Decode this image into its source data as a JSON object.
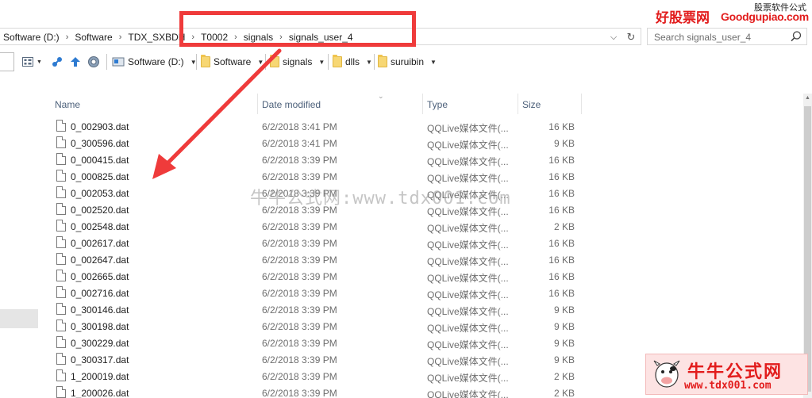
{
  "breadcrumbs": [
    "Software (D:)",
    "Software",
    "TDX_SXBDH",
    "T0002",
    "signals",
    "signals_user_4"
  ],
  "search": {
    "placeholder": "Search signals_user_4"
  },
  "toolbar": {
    "drive_label": "Software (D:)",
    "folders": [
      "Software",
      "signals",
      "dlls",
      "suruibin"
    ]
  },
  "columns": {
    "name": "Name",
    "date": "Date modified",
    "type": "Type",
    "size": "Size"
  },
  "files": [
    {
      "name": "0_002903.dat",
      "date": "6/2/2018 3:41 PM",
      "type": "QQLive媒体文件(...",
      "size": "16 KB"
    },
    {
      "name": "0_300596.dat",
      "date": "6/2/2018 3:41 PM",
      "type": "QQLive媒体文件(...",
      "size": "9 KB"
    },
    {
      "name": "0_000415.dat",
      "date": "6/2/2018 3:39 PM",
      "type": "QQLive媒体文件(...",
      "size": "16 KB"
    },
    {
      "name": "0_000825.dat",
      "date": "6/2/2018 3:39 PM",
      "type": "QQLive媒体文件(...",
      "size": "16 KB"
    },
    {
      "name": "0_002053.dat",
      "date": "6/2/2018 3:39 PM",
      "type": "QQLive媒体文件(...",
      "size": "16 KB"
    },
    {
      "name": "0_002520.dat",
      "date": "6/2/2018 3:39 PM",
      "type": "QQLive媒体文件(...",
      "size": "16 KB"
    },
    {
      "name": "0_002548.dat",
      "date": "6/2/2018 3:39 PM",
      "type": "QQLive媒体文件(...",
      "size": "2 KB"
    },
    {
      "name": "0_002617.dat",
      "date": "6/2/2018 3:39 PM",
      "type": "QQLive媒体文件(...",
      "size": "16 KB"
    },
    {
      "name": "0_002647.dat",
      "date": "6/2/2018 3:39 PM",
      "type": "QQLive媒体文件(...",
      "size": "16 KB"
    },
    {
      "name": "0_002665.dat",
      "date": "6/2/2018 3:39 PM",
      "type": "QQLive媒体文件(...",
      "size": "16 KB"
    },
    {
      "name": "0_002716.dat",
      "date": "6/2/2018 3:39 PM",
      "type": "QQLive媒体文件(...",
      "size": "16 KB"
    },
    {
      "name": "0_300146.dat",
      "date": "6/2/2018 3:39 PM",
      "type": "QQLive媒体文件(...",
      "size": "9 KB"
    },
    {
      "name": "0_300198.dat",
      "date": "6/2/2018 3:39 PM",
      "type": "QQLive媒体文件(...",
      "size": "9 KB"
    },
    {
      "name": "0_300229.dat",
      "date": "6/2/2018 3:39 PM",
      "type": "QQLive媒体文件(...",
      "size": "9 KB"
    },
    {
      "name": "0_300317.dat",
      "date": "6/2/2018 3:39 PM",
      "type": "QQLive媒体文件(...",
      "size": "9 KB"
    },
    {
      "name": "1_200019.dat",
      "date": "6/2/2018 3:39 PM",
      "type": "QQLive媒体文件(...",
      "size": "2 KB"
    },
    {
      "name": "1_200026.dat",
      "date": "6/2/2018 3:39 PM",
      "type": "QQLive媒体文件(...",
      "size": "2 KB"
    }
  ],
  "overlay": {
    "watermark": "牛牛公式网:www.tdx001.com",
    "logo_cn": "好股票网",
    "logo_en": "Goodgupiao.com",
    "logo_tag": "股票软件公式",
    "badge_cn": "牛牛公式网",
    "badge_url": "www.tdx001.com",
    "annotation_color": "#ef3b3b",
    "brand_color": "#e21d1d"
  }
}
